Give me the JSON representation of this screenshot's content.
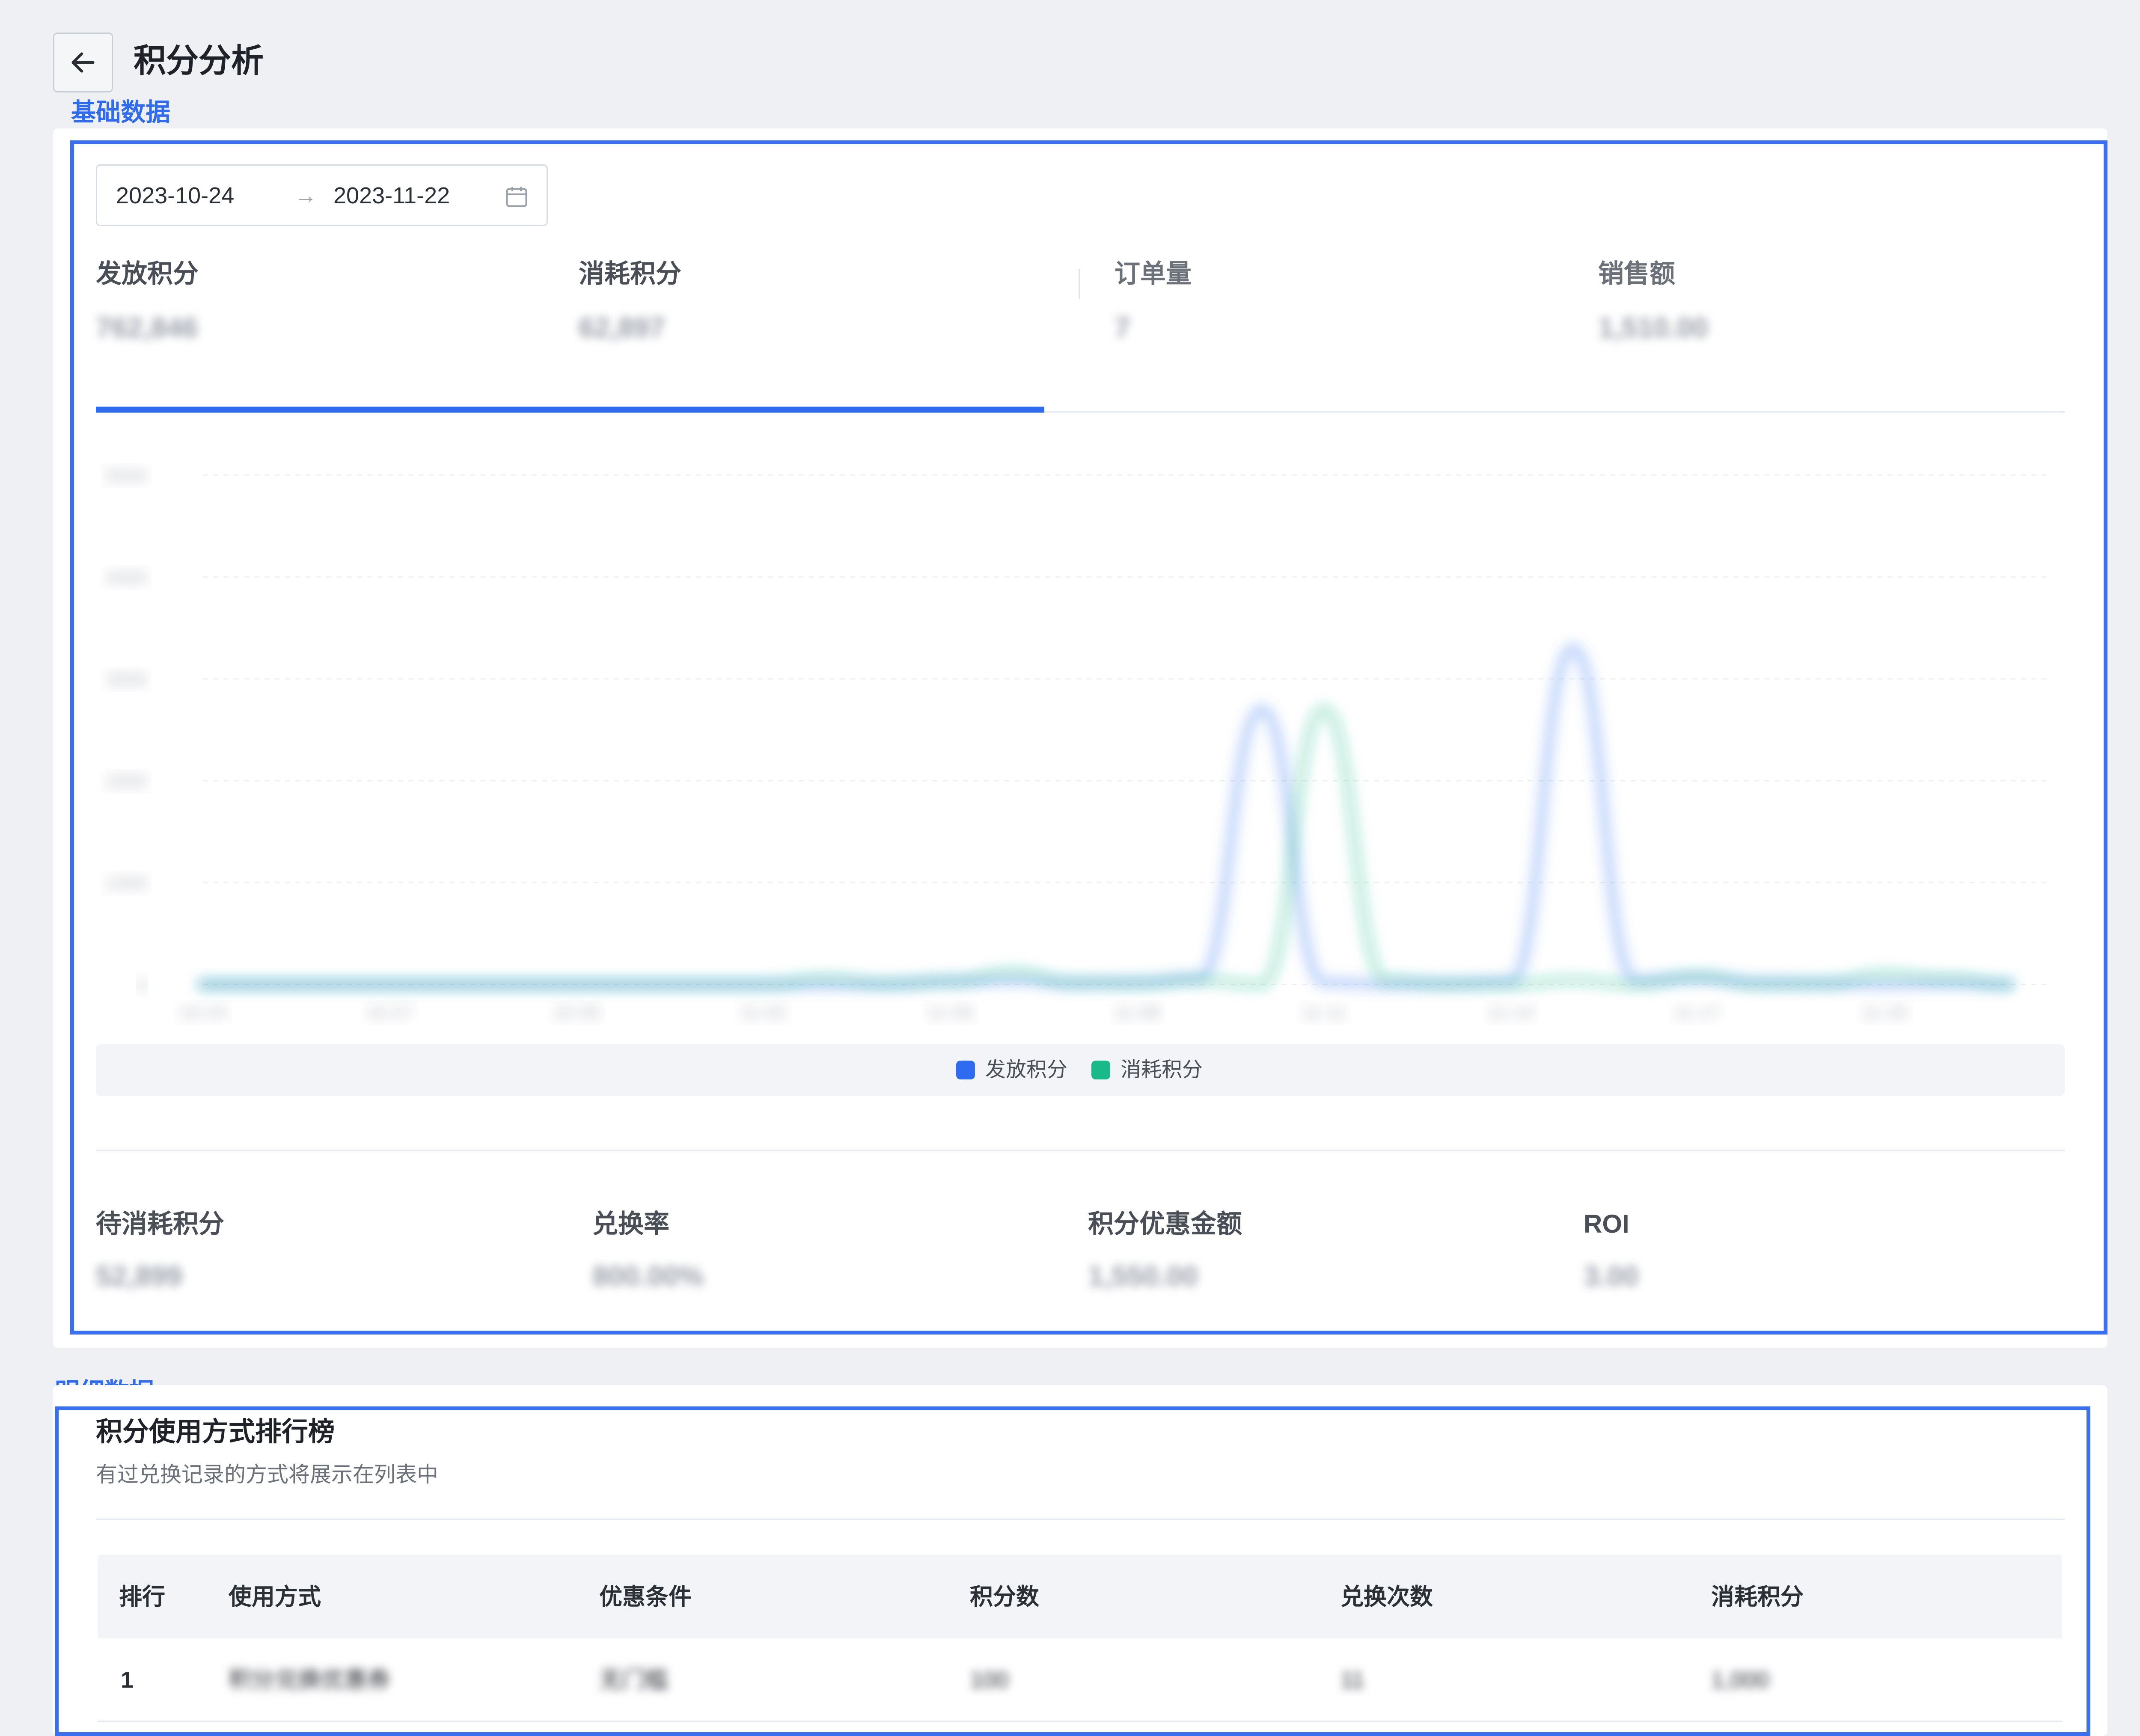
{
  "header": {
    "title": "积分分析",
    "back_icon": "arrow-left-icon"
  },
  "annotations": {
    "basic": "基础数据",
    "detail": "明细数据"
  },
  "date_range": {
    "start": "2023-10-24",
    "separator": "→",
    "end": "2023-11-22",
    "icon": "calendar-icon"
  },
  "metrics_top": [
    {
      "label": "发放积分",
      "value": "762,846"
    },
    {
      "label": "消耗积分",
      "value": "62,897"
    },
    {
      "label": "订单量",
      "value": "7"
    },
    {
      "label": "销售额",
      "value": "1,510.00"
    }
  ],
  "active_tab_index": 0,
  "chart_data": {
    "type": "line",
    "title": "",
    "xlabel": "",
    "ylabel": "",
    "y_ticks": [
      "0",
      "1000",
      "2000",
      "3000",
      "4000",
      "5000"
    ],
    "x_ticks": [
      "10-24",
      "10-27",
      "10-30",
      "11-02",
      "11-05",
      "11-08",
      "11-11",
      "11-14",
      "11-17",
      "11-20"
    ],
    "ylim": [
      0,
      5000
    ],
    "grid": true,
    "legend_position": "bottom",
    "x": [
      "10-24",
      "10-25",
      "10-26",
      "10-27",
      "10-28",
      "10-29",
      "10-30",
      "10-31",
      "11-01",
      "11-02",
      "11-03",
      "11-04",
      "11-05",
      "11-06",
      "11-07",
      "11-08",
      "11-09",
      "11-10",
      "11-11",
      "11-12",
      "11-13",
      "11-14",
      "11-15",
      "11-16",
      "11-17",
      "11-18",
      "11-19",
      "11-20",
      "11-21",
      "11-22"
    ],
    "series": [
      {
        "name": "发放积分",
        "color": "#2f6bf0",
        "values": [
          0,
          0,
          0,
          0,
          0,
          0,
          0,
          0,
          0,
          0,
          0,
          0,
          30,
          40,
          10,
          20,
          60,
          2700,
          20,
          0,
          10,
          30,
          3300,
          40,
          60,
          20,
          10,
          0,
          10,
          0
        ]
      },
      {
        "name": "消耗积分",
        "color": "#1ab98a",
        "values": [
          0,
          0,
          0,
          0,
          0,
          0,
          0,
          0,
          0,
          0,
          60,
          10,
          30,
          120,
          20,
          10,
          40,
          0,
          2700,
          40,
          0,
          0,
          40,
          0,
          80,
          0,
          10,
          100,
          60,
          0
        ]
      }
    ]
  },
  "metrics_bottom": [
    {
      "label": "待消耗积分",
      "value": "52,899"
    },
    {
      "label": "兑换率",
      "value": "800.00%"
    },
    {
      "label": "积分优惠金额",
      "value": "1,550.00"
    },
    {
      "label": "ROI",
      "value": "3.00"
    }
  ],
  "ranking": {
    "title": "积分使用方式排行榜",
    "description": "有过兑换记录的方式将展示在列表中",
    "columns": [
      "排行",
      "使用方式",
      "优惠条件",
      "积分数",
      "兑换次数",
      "消耗积分"
    ],
    "rows": [
      {
        "rank": "1",
        "method": "积分兑换优惠券",
        "condition": "无门槛",
        "points": "100",
        "times": "11",
        "consumed": "1,000"
      }
    ]
  }
}
